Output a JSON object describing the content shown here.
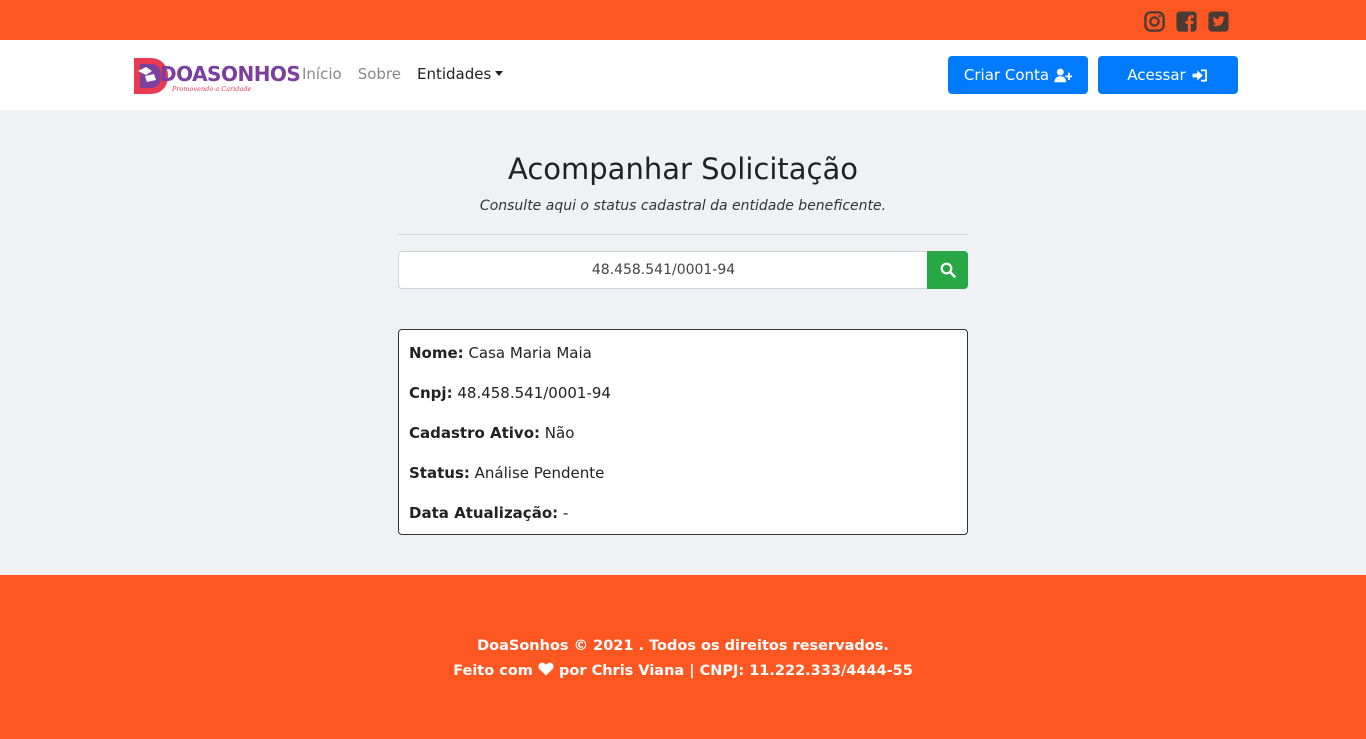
{
  "social": {
    "icons": [
      "instagram-icon",
      "facebook-icon",
      "twitter-icon"
    ],
    "color": "#4a3a35"
  },
  "brand": {
    "name": "DOASONHOS",
    "tagline": "Promovendo a Caridade"
  },
  "nav": {
    "inicio": "Início",
    "sobre": "Sobre",
    "entidades": "Entidades"
  },
  "buttons": {
    "criar_conta": "Criar Conta",
    "acessar": "Acessar"
  },
  "page": {
    "title": "Acompanhar Solicitação",
    "subtitle": "Consulte aqui o status cadastral da entidade beneficente."
  },
  "search": {
    "value": "48.458.541/0001-94"
  },
  "result": {
    "nome_label": "Nome:",
    "nome_value": "Casa Maria Maia",
    "cnpj_label": "Cnpj:",
    "cnpj_value": "48.458.541/0001-94",
    "ativo_label": "Cadastro Ativo:",
    "ativo_value": "Não",
    "status_label": "Status:",
    "status_value": "Análise Pendente",
    "data_label": "Data Atualização:",
    "data_value": "-"
  },
  "footer": {
    "line1": "DoaSonhos © 2021 . Todos os direitos reservados.",
    "line2_pre": "Feito com",
    "line2_post": "por Chris Viana | CNPJ: 11.222.333/4444-55"
  },
  "colors": {
    "accent": "#ff5722",
    "primary": "#007bff",
    "success": "#28a745"
  }
}
